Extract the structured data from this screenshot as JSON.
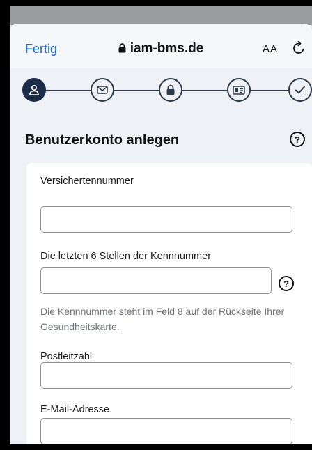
{
  "browser": {
    "done_label": "Fertig",
    "url": "iam-bms.de",
    "text_size_label": "AA"
  },
  "steps": [
    {
      "name": "account",
      "state": "active"
    },
    {
      "name": "email",
      "state": "pending"
    },
    {
      "name": "password",
      "state": "pending"
    },
    {
      "name": "id-card",
      "state": "pending"
    },
    {
      "name": "done",
      "state": "pending"
    }
  ],
  "page": {
    "title": "Benutzerkonto anlegen",
    "help_symbol": "?"
  },
  "form": {
    "insurance_number": {
      "label": "Versichertennummer",
      "value": ""
    },
    "id_digits": {
      "label": "Die letzten 6 Stellen der Kennnummer",
      "value": "",
      "help_symbol": "?",
      "hint": "Die Kennnummer steht im Feld 8 auf der Rückseite Ihrer Gesundheitskarte."
    },
    "postal_code": {
      "label": "Postleitzahl",
      "value": ""
    },
    "email": {
      "label": "E-Mail-Adresse",
      "value": ""
    }
  },
  "colors": {
    "accent": "#1a6ad8",
    "step_active": "#1c2d4a",
    "step_outline": "#2d3a4a"
  }
}
